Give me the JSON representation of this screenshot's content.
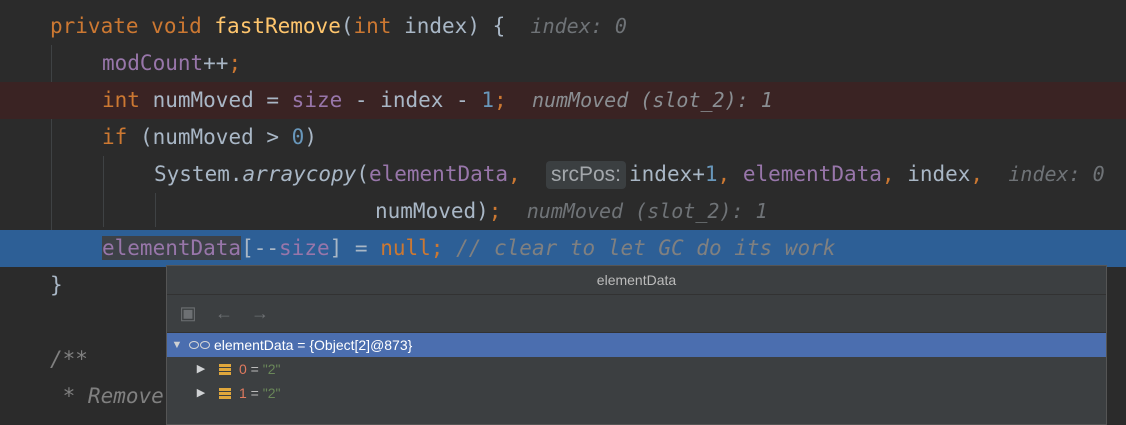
{
  "code": {
    "line1": {
      "kw_private": "private",
      "kw_void": "void",
      "method": "fastRemove",
      "open_paren": "(",
      "kw_int": "int",
      "param": "index",
      "close": ") {",
      "hint": "index: 0"
    },
    "line2": {
      "field": "modCount",
      "rest": "++",
      "semi": ";"
    },
    "line3": {
      "kw_int": "int",
      "text_a": "numMoved = ",
      "field": "size",
      "text_b": " - index - ",
      "num": "1",
      "semi": ";",
      "hint": "numMoved (slot_2): 1"
    },
    "line4": {
      "kw_if": "if",
      "text_a": " (numMoved > ",
      "num": "0",
      "text_b": ")"
    },
    "line5": {
      "text_a": "System.",
      "method": "arraycopy",
      "text_b": "(",
      "field1": "elementData",
      "comma1": ", ",
      "param_hint": "srcPos:",
      "text_c": "index+",
      "num": "1",
      "comma2": ", ",
      "field2": "elementData",
      "comma3": ", ",
      "text_d": "index",
      "comma4": ",",
      "hint": "index: 0"
    },
    "line6": {
      "text": "numMoved)",
      "semi": ";",
      "hint": "numMoved (slot_2): 1"
    },
    "line7": {
      "field": "elementData",
      "bracket_open": "[",
      "dec": "--",
      "field2": "size",
      "bracket_close": "]",
      "eq": " = ",
      "kw_null": "null",
      "semi": ";",
      "comment": " // clear to let GC do its work"
    },
    "line8": {
      "brace": "}"
    },
    "line10": {
      "comment": "/**"
    },
    "line11": {
      "comment": " * Remove"
    }
  },
  "popup": {
    "title": "elementData",
    "toolbar": {
      "icons": [
        "folder-icon",
        "back-arrow-icon",
        "forward-arrow-icon"
      ]
    },
    "tree": {
      "root": {
        "name": "elementData",
        "eq": " = ",
        "value": "{Object[2]@873}"
      },
      "children": [
        {
          "key": "0",
          "eq": " = ",
          "value": "\"2\""
        },
        {
          "key": "1",
          "eq": " = ",
          "value": "\"2\""
        }
      ]
    }
  },
  "colors": {
    "background": "#2b2b2b",
    "keyword": "#cc7832",
    "method": "#ffc66d",
    "field": "#9876aa",
    "number": "#6897bb",
    "execution_line": "#2d5f96",
    "breakpoint_line": "#3a2323",
    "tree_selection": "#4b6eaf"
  }
}
